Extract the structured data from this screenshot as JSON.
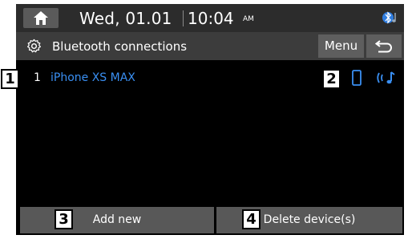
{
  "status_bar": {
    "home_icon": "home-icon",
    "date": "Wed, 01.01",
    "time": "10:04",
    "ampm": "AM",
    "bt_status_icon": "bluetooth-audio-icon"
  },
  "title_bar": {
    "icon": "gear-icon",
    "title": "Bluetooth connections",
    "menu_label": "Menu",
    "back_icon": "back-arrow-icon"
  },
  "devices": [
    {
      "index": "1",
      "name": "iPhone XS MAX",
      "icons": [
        "phone-icon",
        "bluetooth-audio-icon"
      ]
    }
  ],
  "buttons": {
    "add_new": "Add new",
    "delete_devices": "Delete device(s)"
  },
  "callouts": [
    "1",
    "2",
    "3",
    "4"
  ],
  "colors": {
    "device_name": "#3a8ff2",
    "screen_bg": "#000000",
    "button_bg": "#585858",
    "header_bg": "#3c3c3c"
  }
}
